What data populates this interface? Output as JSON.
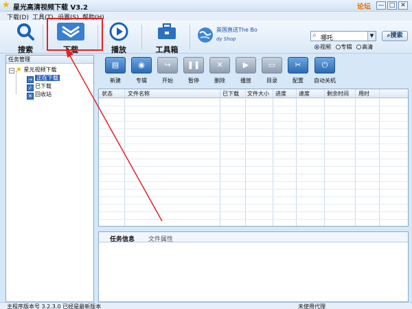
{
  "window": {
    "title": "星光高清视频下载 V3.2",
    "forum_link": "论坛",
    "minimize": "—",
    "maximize": "□",
    "close": "✕"
  },
  "menu": [
    "下载(D)",
    "工具(T)",
    "设置(S)",
    "帮助(H)"
  ],
  "toolbar": {
    "search": "搜索",
    "download": "下载",
    "play": "播放",
    "toolbox": "工具箱",
    "partner_text": "英国直送The Bo",
    "partner_sub": "dy Shop"
  },
  "search": {
    "value": "哪吒",
    "button": "搜索",
    "options": [
      "视频",
      "专辑",
      "高清"
    ],
    "selected_option": "视频"
  },
  "tree": {
    "header": "任务管理",
    "root": "星光视频下载",
    "items": [
      {
        "label": "正在下载",
        "selected": true
      },
      {
        "label": "已下载",
        "selected": false
      },
      {
        "label": "回收站",
        "selected": false
      }
    ]
  },
  "actions": [
    "新建",
    "专辑",
    "开始",
    "暂停",
    "删除",
    "播放",
    "目录",
    "配置",
    "自动关机"
  ],
  "table": {
    "columns": [
      "状态",
      "文件名称",
      "已下载",
      "文件大小",
      "进度",
      "速度",
      "剩余时间",
      "用时"
    ]
  },
  "info": {
    "tabs": [
      "任务信息",
      "文件属性"
    ],
    "active_tab": "任务信息"
  },
  "status": {
    "version": "主程序版本号 3.2.3.0  已经是最新版本",
    "proxy": "未使用代理"
  },
  "colors": {
    "accent": "#2d62b8",
    "highlight_box": "#e32020",
    "forum": "#e46d00"
  }
}
